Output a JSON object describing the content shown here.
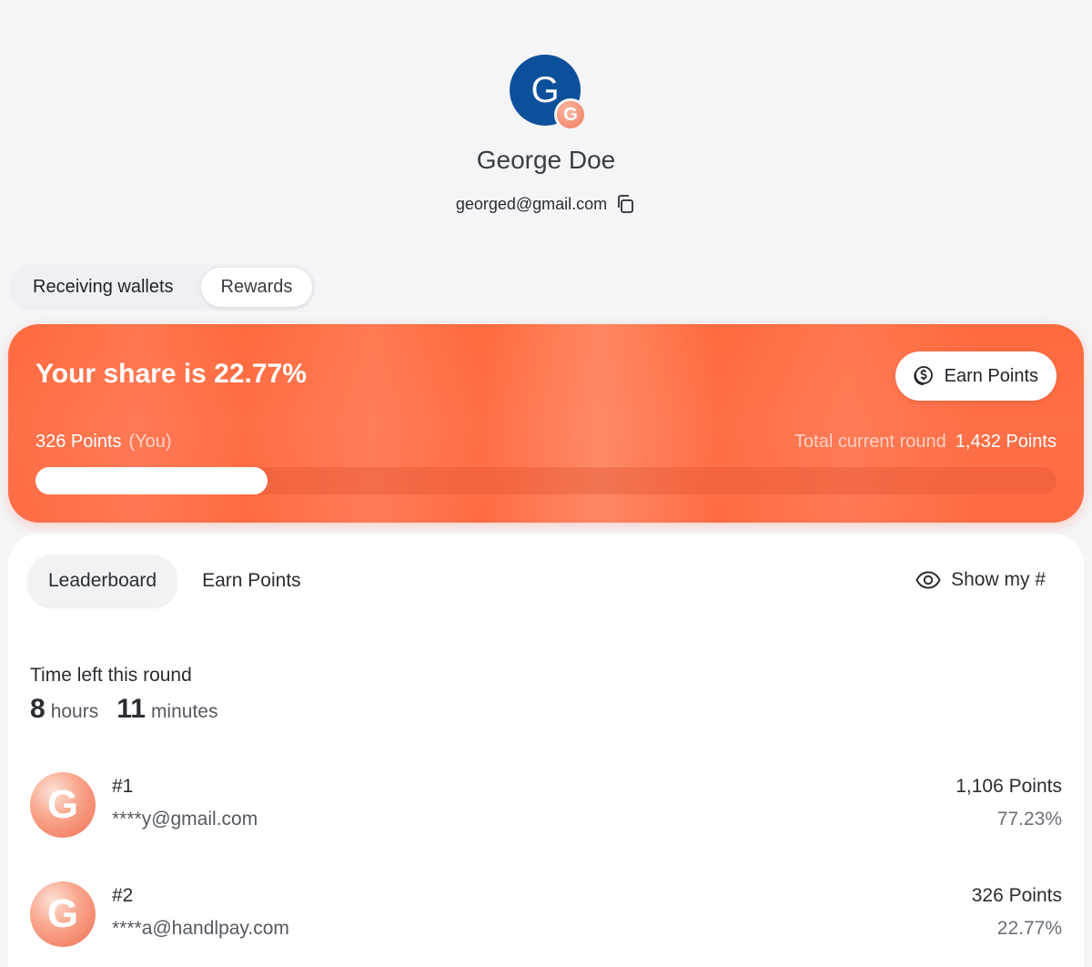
{
  "profile": {
    "avatar_letter": "G",
    "badge_letter": "G",
    "name": "George Doe",
    "email": "georged@gmail.com"
  },
  "tabs": {
    "receiving_wallets": "Receiving wallets",
    "rewards": "Rewards",
    "active": "rewards"
  },
  "share": {
    "title": "Your share is 22.77%",
    "earn_button": "Earn Points",
    "my_points": "326 Points",
    "you_label": "(You)",
    "total_label": "Total current round",
    "total_value": "1,432 Points",
    "progress_fraction": 0.2277
  },
  "panel": {
    "tab_leaderboard": "Leaderboard",
    "tab_earn": "Earn Points",
    "show_my": "Show my #"
  },
  "round": {
    "label": "Time left this round",
    "hours_value": "8",
    "hours_unit": "hours",
    "minutes_value": "11",
    "minutes_unit": "minutes"
  },
  "leaderboard": [
    {
      "avatar_letter": "G",
      "rank": "#1",
      "email": "****y@gmail.com",
      "points": "1,106 Points",
      "percent": "77.23%"
    },
    {
      "avatar_letter": "G",
      "rank": "#2",
      "email": "****a@handlpay.com",
      "points": "326 Points",
      "percent": "22.77%"
    }
  ],
  "colors": {
    "accent": "#ff6a3e",
    "avatar_blue": "#0c4f9a"
  },
  "icons": {
    "copy": "copy-icon",
    "earn": "coin-dollar-icon",
    "show": "eye-icon"
  }
}
